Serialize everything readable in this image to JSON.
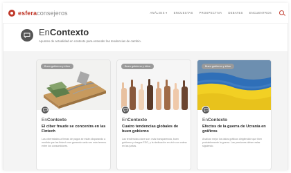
{
  "header": {
    "logo_prefix": "esfera",
    "logo_suffix": "consejeros",
    "nav": [
      "Análisis ▾",
      "Encuestas",
      "Prospectiva",
      "Debates",
      "Encuentros"
    ]
  },
  "section": {
    "title_light": "En",
    "title_bold": "Contexto",
    "subtitle": "Apuntes de actualidad en contexto para entender las tendencias de cambio."
  },
  "cards": [
    {
      "tag": "Buen gobierno y ética",
      "brand_light": "En",
      "brand_bold": "Contexto",
      "title": "El ciber fraude se concentra en las Fintech",
      "excerpt": "Las ciberestafas a firmas de pagos se están disparando a medida que las fintech van ganando cada vez más terreno entre los consumidores."
    },
    {
      "tag": "Buen gobierno y ética",
      "brand_light": "En",
      "brand_bold": "Contexto",
      "title": "Cuatro tendencias globales de buen gobierno",
      "excerpt": "Las tendencias clave son: más transparencia, buen gobierno y riesgos ESG, y la dedicación en vivir con calma en las juntas."
    },
    {
      "tag": "Buen gobierno y ética",
      "brand_light": "En",
      "brand_bold": "Contexto",
      "title": "Efectos de la guerra de Ucrania en gráficos",
      "excerpt": "Analizar mejor los datos gráficos dirigiéndole que bien probablemente la guerra. Las presiones deben estar siguiendo."
    }
  ],
  "colors": {
    "accent": "#c0392b",
    "icon_dark": "#555555",
    "tag_bg": "#9a9a9a",
    "band": "#f4f4f4"
  },
  "icons": {
    "head": "speech-bubble-icon",
    "search": "search-icon"
  }
}
